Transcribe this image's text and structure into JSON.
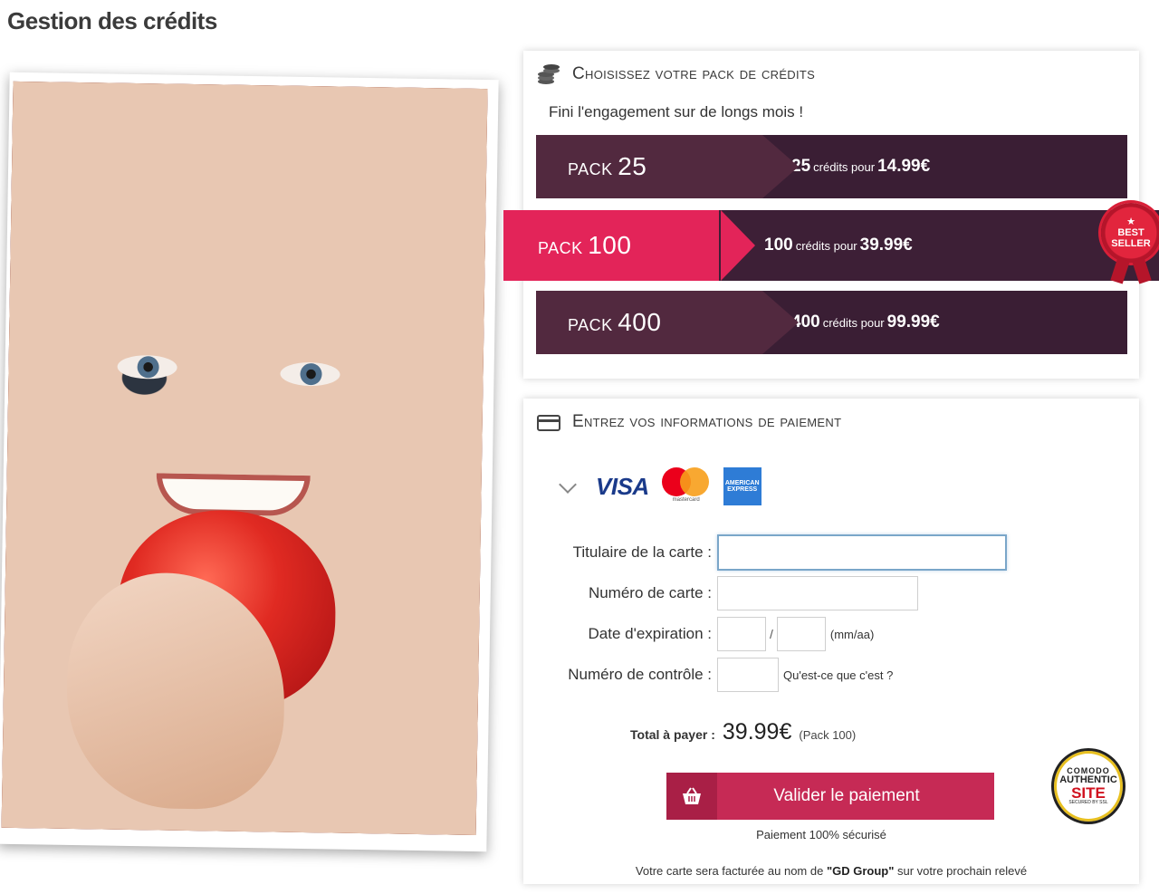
{
  "page": {
    "title": "Gestion des crédits"
  },
  "packs_card": {
    "title": "Choisissez votre pack de crédits",
    "tagline": "Fini l'engagement sur de longs mois !",
    "badge_line1": "BEST",
    "badge_line2": "SELLER",
    "packs": [
      {
        "name_prefix": "PACK",
        "name_number": "25",
        "credits": "25",
        "credits_word": "crédits pour",
        "price": "14.99€",
        "selected": false
      },
      {
        "name_prefix": "PACK",
        "name_number": "100",
        "credits": "100",
        "credits_word": "crédits pour",
        "price": "39.99€",
        "selected": true
      },
      {
        "name_prefix": "PACK",
        "name_number": "400",
        "credits": "400",
        "credits_word": "crédits pour",
        "price": "99.99€",
        "selected": false
      }
    ]
  },
  "payment_card": {
    "title": "Entrez vos informations de paiement",
    "brands": {
      "visa": "VISA",
      "mastercard": "mastercard",
      "amex": "AMERICAN EXPRESS"
    },
    "fields": {
      "holder_label": "Titulaire de la carte :",
      "holder_value": "",
      "number_label": "Numéro de carte :",
      "number_value": "",
      "expiry_label": "Date d'expiration :",
      "expiry_month": "",
      "expiry_year": "",
      "expiry_separator": "/",
      "expiry_hint": "(mm/aa)",
      "cvv_label": "Numéro de contrôle :",
      "cvv_value": "",
      "cvv_help": "Qu'est-ce que c'est ?"
    },
    "total": {
      "label": "Total à payer :",
      "amount": "39.99€",
      "pack": "(Pack 100)"
    },
    "submit_label": "Valider le paiement",
    "secure_text": "Paiement 100% sécurisé",
    "billing_prefix": "Votre carte sera facturée au nom de ",
    "billing_company": "\"GD Group\"",
    "billing_suffix": " sur votre prochain relevé",
    "comodo": {
      "top": "COMODO",
      "mid": "AUTHENTIC",
      "site": "SITE",
      "bottom": "SECURED BY SSL"
    }
  },
  "colors": {
    "pack_dark": "#3a1e34",
    "pack_mid": "#52293f",
    "pack_selected": "#e32459",
    "submit": "#c62a55"
  }
}
